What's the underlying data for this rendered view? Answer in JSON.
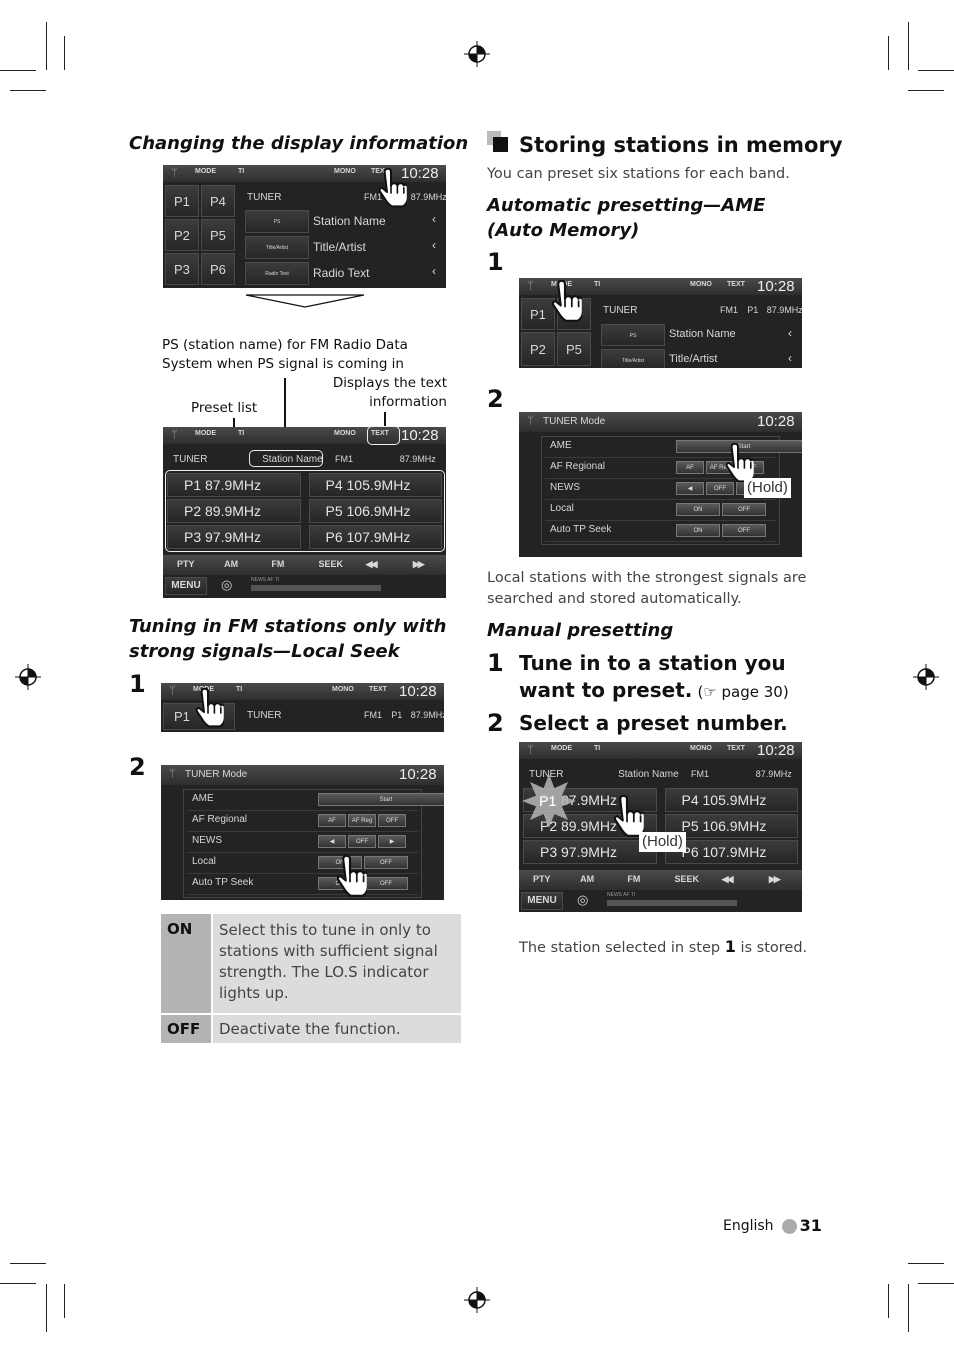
{
  "left": {
    "heading1": "Changing the display information",
    "ps_note": "PS (station name) for FM Radio Data System when PS signal is coming in",
    "text_note": "Displays the text information",
    "preset_note": "Preset list",
    "heading2": "Tuning in FM stations only with strong signals—Local Seek",
    "step1": "1",
    "step2": "2",
    "table": [
      {
        "key": "ON",
        "desc": "Select this to tune in only to stations with sufficient signal strength. The LO.S indicator lights up."
      },
      {
        "key": "OFF",
        "desc": "Deactivate the function."
      }
    ]
  },
  "right": {
    "title": "Storing stations in memory",
    "intro": "You can preset six stations for each band.",
    "auto_heading": "Automatic presetting—AME (Auto Memory)",
    "step1": "1",
    "step2": "2",
    "auto_note": "Local stations with the strongest signals are searched and stored automatically.",
    "manual_heading": "Manual presetting",
    "m_step1_num": "1",
    "m_step1": "Tune in to a station you want to preset.",
    "m_step1_ref": "(☞ page 30)",
    "m_step2_num": "2",
    "m_step2": "Select a preset number.",
    "result_pre": "The station selected in step",
    "result_num": "1",
    "result_post": "is stored."
  },
  "footer": {
    "language": "English",
    "page": "31"
  },
  "hold_label": "(Hold)",
  "screens": {
    "topbar": {
      "mode": "MODE",
      "ti": "TI",
      "mono": "MONO",
      "text": "TEXT",
      "time": "10:28"
    },
    "tuner": {
      "source": "TUNER",
      "band": "FM1",
      "preset": "P1",
      "freq": "87.9MHz",
      "ps": "Station Name"
    },
    "display_rows": [
      {
        "small": "PS",
        "big": "Station Name"
      },
      {
        "small": "Title/Artist",
        "big": "Title/Artist"
      },
      {
        "small": "Radio Text",
        "big": "Radio Text"
      }
    ],
    "preset_buttons": [
      "P1",
      "P4",
      "P2",
      "P5",
      "P3",
      "P6"
    ],
    "presets": [
      {
        "p": "P1",
        "f": "87.9MHz"
      },
      {
        "p": "P4",
        "f": "105.9MHz"
      },
      {
        "p": "P2",
        "f": "89.9MHz"
      },
      {
        "p": "P5",
        "f": "106.9MHz"
      },
      {
        "p": "P3",
        "f": "97.9MHz"
      },
      {
        "p": "P6",
        "f": "107.9MHz"
      }
    ],
    "bottom_buttons": [
      "PTY",
      "AM",
      "FM",
      "SEEK",
      "◀◀",
      "▶▶"
    ],
    "menu_label": "MENU",
    "indicators": "NEWS  AF  TI",
    "menu_title": "TUNER Mode",
    "menu_rows": [
      {
        "label": "AME",
        "buttons": [
          "Start"
        ]
      },
      {
        "label": "AF Regional",
        "buttons": [
          "AF",
          "AF Reg",
          "OFF"
        ]
      },
      {
        "label": "NEWS",
        "buttons": [
          "◀",
          "OFF",
          "▶"
        ]
      },
      {
        "label": "Local",
        "buttons": [
          "ON",
          "OFF"
        ]
      },
      {
        "label": "Auto TP Seek",
        "buttons": [
          "ON",
          "OFF"
        ]
      }
    ]
  }
}
